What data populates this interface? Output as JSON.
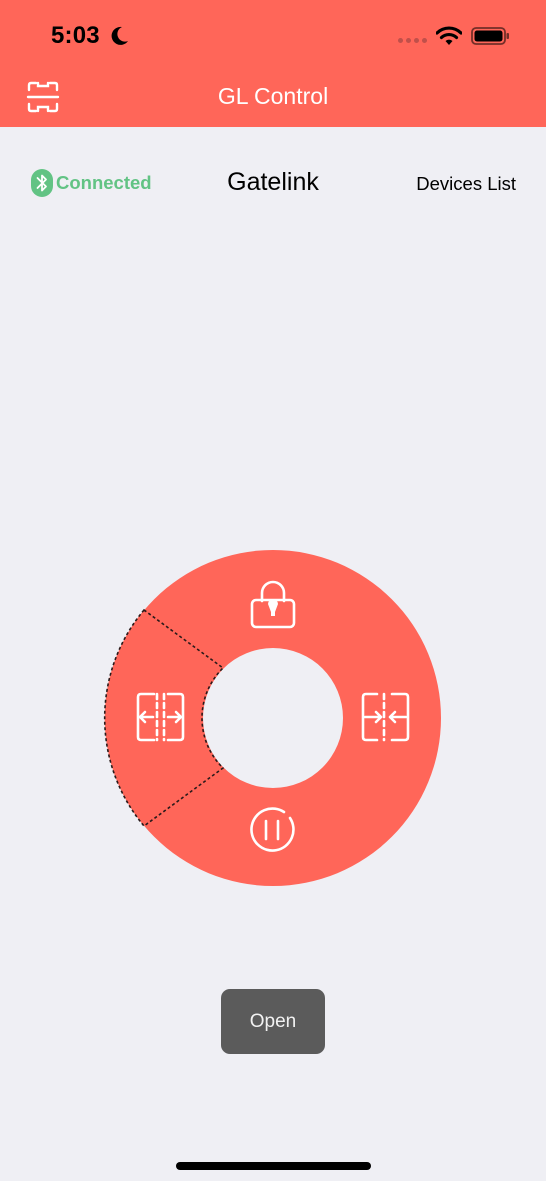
{
  "status_bar": {
    "time": "5:03",
    "icons": [
      "moon-icon",
      "signal-dots-icon",
      "wifi-icon",
      "battery-icon"
    ]
  },
  "nav": {
    "title": "GL Control",
    "left_icon": "scan-icon"
  },
  "connection": {
    "status": "Connected",
    "device_name": "Gatelink",
    "devices_link": "Devices List",
    "icon": "bluetooth-icon"
  },
  "control_wheel": {
    "segments": [
      {
        "name": "lock",
        "icon": "lock-icon"
      },
      {
        "name": "close",
        "icon": "gate-close-icon"
      },
      {
        "name": "pause",
        "icon": "pause-icon"
      },
      {
        "name": "open",
        "icon": "gate-open-icon",
        "selected": true
      }
    ]
  },
  "toast": {
    "text": "Open"
  },
  "colors": {
    "accent": "#ff6659",
    "background": "#efeff4",
    "connected": "#62c384",
    "toast_bg": "#5b5b5b"
  }
}
